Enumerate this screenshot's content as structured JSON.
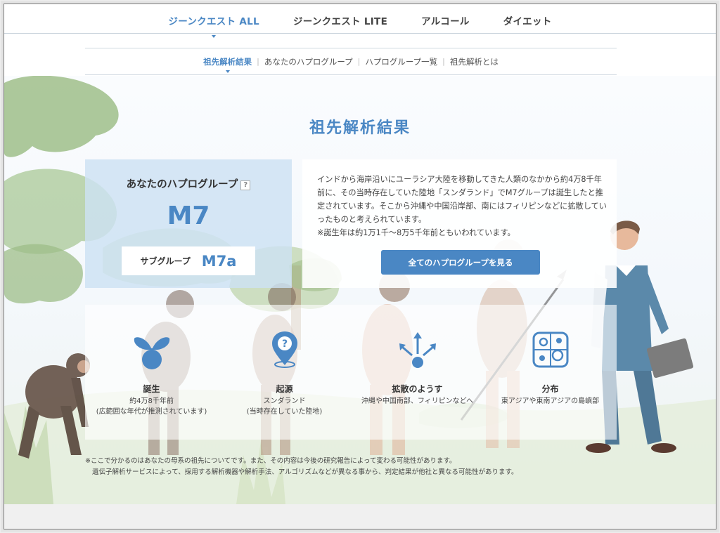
{
  "top_nav": {
    "tabs": [
      {
        "label": "ジーンクエスト ALL",
        "active": true
      },
      {
        "label": "ジーンクエスト LITE",
        "active": false
      },
      {
        "label": "アルコール",
        "active": false
      },
      {
        "label": "ダイエット",
        "active": false
      }
    ]
  },
  "sub_nav": {
    "items": [
      {
        "label": "祖先解析結果",
        "active": true
      },
      {
        "label": "あなたのハプログループ",
        "active": false
      },
      {
        "label": "ハプログループ一覧",
        "active": false
      },
      {
        "label": "祖先解析とは",
        "active": false
      }
    ]
  },
  "page_title": "祖先解析結果",
  "haplogroup": {
    "label": "あなたのハプログループ",
    "help_icon": "?",
    "value": "M7",
    "subgroup_label": "サブグループ",
    "subgroup_value": "M7a"
  },
  "description": {
    "text": "インドから海岸沿いにユーラシア大陸を移動してきた人類のなかから約4万8千年前に、その当時存在していた陸地「スンダランド」でM7グループは誕生したと推定されています。そこから沖縄や中国沿岸部、南にはフィリピンなどに拡散していったものと考えられています。",
    "note": "※誕生年は約1万1千〜8万5千年前ともいわれています。",
    "button_label": "全てのハプログループを見る"
  },
  "info_items": [
    {
      "icon": "sprout-icon",
      "title": "誕生",
      "line1": "約4万8千年前",
      "line2": "(広範囲な年代が推測されています)"
    },
    {
      "icon": "location-pin-icon",
      "title": "起源",
      "line1": "スンダランド",
      "line2": "(当時存在していた陸地)"
    },
    {
      "icon": "spread-arrows-icon",
      "title": "拡散のようす",
      "line1": "沖縄や中国南部、フィリピンなどへ",
      "line2": ""
    },
    {
      "icon": "map-grid-icon",
      "title": "分布",
      "line1": "東アジアや東南アジアの島嶼部",
      "line2": ""
    }
  ],
  "footnote": {
    "line1": "※ここで分かるのはあなたの母系の祖先についてです。また、その内容は今後の研究報告によって変わる可能性があります。",
    "line2": "遺伝子解析サービスによって、採用する解析機器や解析手法、アルゴリズムなどが異なる事から、判定結果が他社と異なる可能性があります。"
  },
  "colors": {
    "accent": "#4a87c4",
    "panel_blue": "#cde2f3"
  }
}
